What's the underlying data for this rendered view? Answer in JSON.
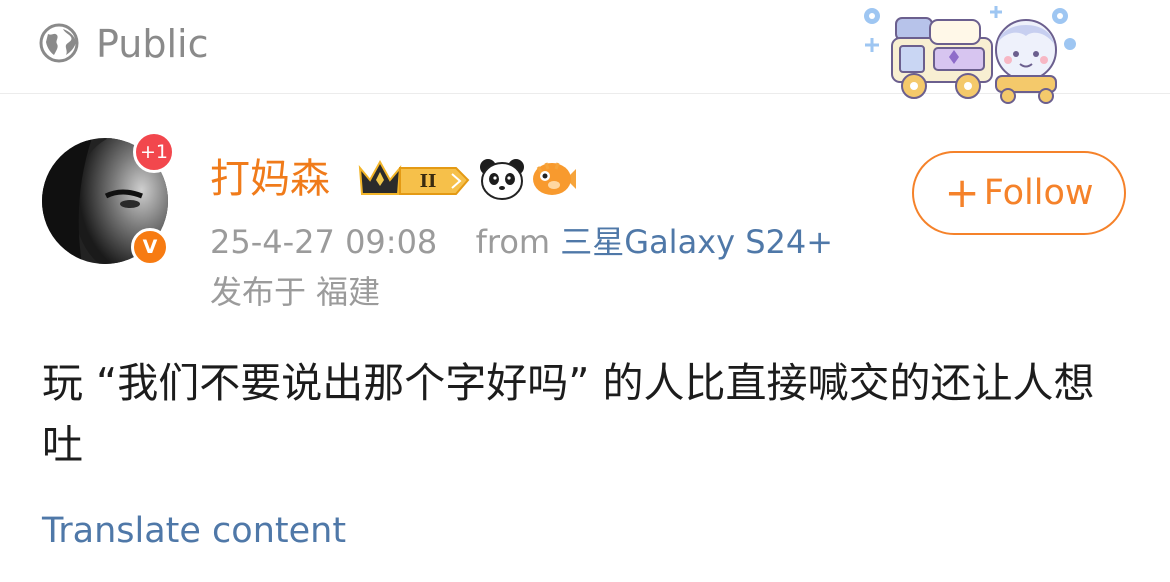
{
  "visibility": {
    "icon": "globe-icon",
    "label": "Public"
  },
  "header_decoration": {
    "icon": "cartoon-train-decoration"
  },
  "author": {
    "name": "打妈森",
    "notification_badge": "+1",
    "verified_badge": "V",
    "icons": [
      "crown-level-icon",
      "panda-icon",
      "puffer-fish-icon"
    ],
    "level_text": "II",
    "name_color": "#f07b1a"
  },
  "follow_button": {
    "plus": "+",
    "label": "Follow",
    "color": "#f5822a"
  },
  "meta": {
    "timestamp": "25-4-27 09:08",
    "from_label": "from",
    "device": "三星Galaxy S24+",
    "location": "发布于 福建"
  },
  "post": {
    "text": "玩 “我们不要说出那个字好吗” 的人比直接喊交的还让人想吐"
  },
  "translate": {
    "label": "Translate content",
    "color": "#4f78a8"
  }
}
